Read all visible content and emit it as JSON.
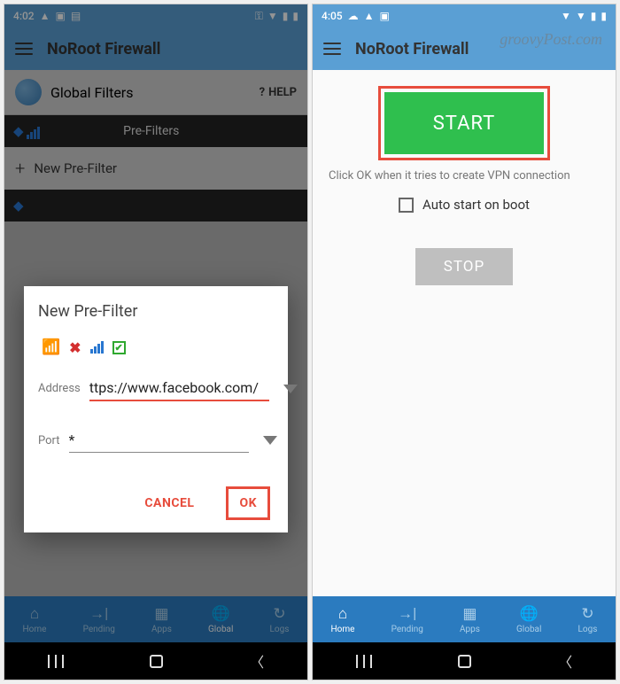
{
  "watermark": "groovyPost.com",
  "left": {
    "time": "4:02",
    "app_title": "NoRoot Firewall",
    "global_filters_label": "Global Filters",
    "help_label": "HELP",
    "tab_label": "Pre-Filters",
    "new_filter_label": "New Pre-Filter",
    "dialog": {
      "title": "New Pre-Filter",
      "address_label": "Address",
      "address_value": "ttps://www.facebook.com/",
      "port_label": "Port",
      "port_value": "*",
      "cancel_label": "CANCEL",
      "ok_label": "OK"
    },
    "nav": {
      "home": "Home",
      "pending": "Pending",
      "apps": "Apps",
      "global": "Global",
      "logs": "Logs"
    }
  },
  "right": {
    "time": "4:05",
    "app_title": "NoRoot Firewall",
    "start_label": "START",
    "hint": "Click OK when it tries to create VPN connection",
    "checkbox_label": "Auto start on boot",
    "stop_label": "STOP",
    "nav": {
      "home": "Home",
      "pending": "Pending",
      "apps": "Apps",
      "global": "Global",
      "logs": "Logs"
    }
  }
}
